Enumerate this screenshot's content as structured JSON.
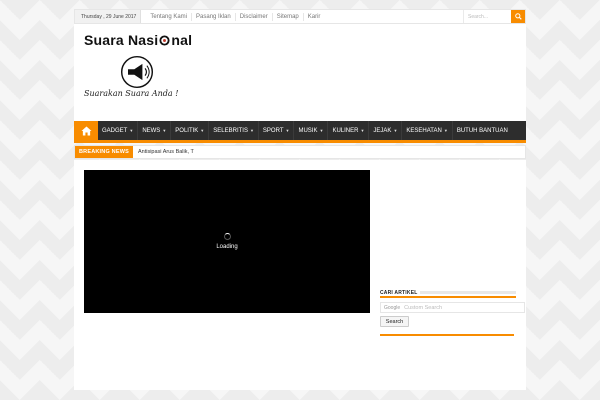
{
  "topbar": {
    "date": "Thursday , 29 June 2017",
    "links": [
      "Tentang Kami",
      "Pasang Iklan",
      "Disclaimer",
      "Sitemap",
      "Karir"
    ],
    "search_placeholder": "Search..."
  },
  "header": {
    "logo_text_1": "Suara Nasi",
    "logo_text_2": "nal",
    "tagline": "Suarakan Suara Anda !"
  },
  "nav": {
    "items": [
      {
        "label": "GADGET",
        "dropdown": true
      },
      {
        "label": "NEWS",
        "dropdown": true
      },
      {
        "label": "POLITIK",
        "dropdown": true
      },
      {
        "label": "SELEBRITIS",
        "dropdown": true
      },
      {
        "label": "SPORT",
        "dropdown": true
      },
      {
        "label": "MUSIK",
        "dropdown": true
      },
      {
        "label": "KULINER",
        "dropdown": true
      },
      {
        "label": "JEJAK",
        "dropdown": true
      },
      {
        "label": "KESEHATAN",
        "dropdown": true
      },
      {
        "label": "BUTUH BANTUAN",
        "dropdown": false
      }
    ]
  },
  "breaking": {
    "label": "BREAKING NEWS",
    "text": "Antisipasi Arus Balik, T"
  },
  "video": {
    "status": "Loading"
  },
  "sidebar": {
    "widget_title": "CARI ARTIKEL",
    "google_label": "Google",
    "search_placeholder": "Custom Search",
    "search_button": "Search"
  },
  "colors": {
    "accent": "#f88c00",
    "nav_bg": "#2d2d2d"
  }
}
